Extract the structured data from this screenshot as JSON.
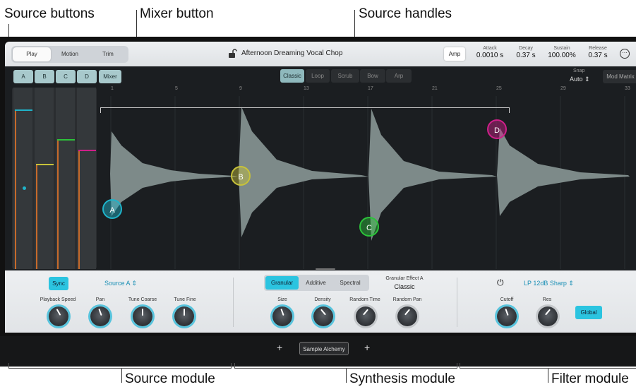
{
  "callouts": {
    "source_buttons": "Source buttons",
    "mixer_button": "Mixer button",
    "source_handles": "Source handles",
    "source_module": "Source module",
    "synthesis_module": "Synthesis module",
    "filter_module": "Filter module"
  },
  "header": {
    "tabs": [
      "Play",
      "Motion",
      "Trim"
    ],
    "active_tab": "Play",
    "preset": "Afternoon Dreaming Vocal Chop",
    "amp": "Amp",
    "env": [
      {
        "label": "Attack",
        "value": "0.0010 s"
      },
      {
        "label": "Decay",
        "value": "0.37 s"
      },
      {
        "label": "Sustain",
        "value": "100.00%"
      },
      {
        "label": "Release",
        "value": "0.37 s"
      }
    ]
  },
  "sources": [
    "A",
    "B",
    "C",
    "D"
  ],
  "mixer": "Mixer",
  "modes": [
    "Classic",
    "Loop",
    "Scrub",
    "Bow",
    "Arp"
  ],
  "active_mode": "Classic",
  "snap": {
    "label": "Snap",
    "value": "Auto"
  },
  "mod_matrix": "Mod Matrix",
  "ruler": [
    "1",
    "5",
    "9",
    "13",
    "17",
    "21",
    "25",
    "29",
    "33"
  ],
  "mixer_levels": [
    0.9,
    0.57,
    0.75,
    0.66
  ],
  "source_module": {
    "sync": "Sync",
    "source": "Source A",
    "knobs": [
      "Playback Speed",
      "Pan",
      "Tune Coarse",
      "Tune Fine"
    ]
  },
  "synthesis_module": {
    "modes": [
      "Granular",
      "Additive",
      "Spectral"
    ],
    "active": "Granular",
    "effect_label": "Granular Effect A",
    "effect_value": "Classic",
    "knobs": [
      "Size",
      "Density",
      "Random Time",
      "Random Pan"
    ]
  },
  "filter_module": {
    "type": "LP 12dB Sharp",
    "knobs": [
      "Cutoff",
      "Res"
    ],
    "global": "Global"
  },
  "footer": {
    "plugin": "Sample Alchemy"
  },
  "colors": {
    "A": "#1fb3c9",
    "B": "#c7c23a",
    "C": "#2cc23a",
    "D": "#cf1f8a",
    "accent": "#58c4dd"
  }
}
